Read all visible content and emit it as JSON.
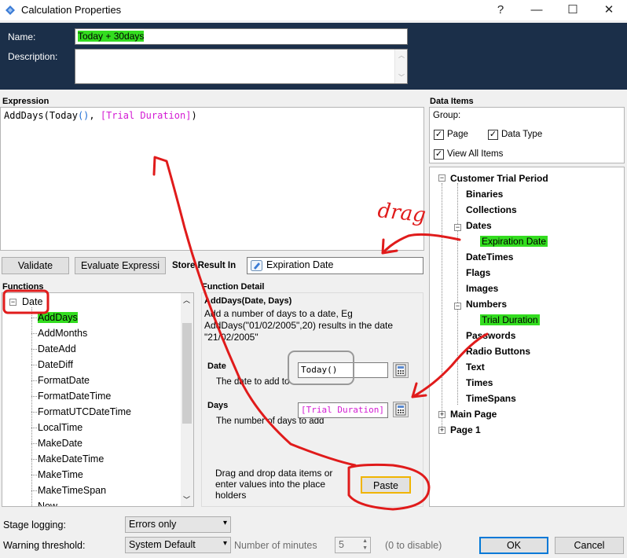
{
  "window": {
    "title": "Calculation Properties",
    "help": "?",
    "minimize": "—",
    "maximize": "☐",
    "close": "✕"
  },
  "header": {
    "name_label": "Name:",
    "name_value": "Today + 30days",
    "description_label": "Description:",
    "description_value": ""
  },
  "expression": {
    "label": "Expression",
    "fn": "AddDays",
    "open": "(",
    "fn2": "Today",
    "parens": "()",
    "sep": ", ",
    "data_item": "[Trial Duration]",
    "close": ")"
  },
  "actions": {
    "validate": "Validate",
    "evaluate": "Evaluate Expressi",
    "store_label": "Store Result In",
    "store_value": "Expiration Date"
  },
  "functions": {
    "label": "Functions",
    "group": "Date",
    "items": [
      "AddDays",
      "AddMonths",
      "DateAdd",
      "DateDiff",
      "FormatDate",
      "FormatDateTime",
      "FormatUTCDateTime",
      "LocalTime",
      "MakeDate",
      "MakeDateTime",
      "MakeTime",
      "MakeTimeSpan",
      "Now"
    ]
  },
  "detail": {
    "label": "Function Detail",
    "signature": "AddDays(Date, Days)",
    "description": "Add a number of days to a date, Eg AddDays(\"01/02/2005\",20) results in the date \"21/02/2005\"",
    "param1_name": "Date",
    "param1_desc": "The date to add to",
    "param1_value": "Today()",
    "param2_name": "Days",
    "param2_desc": "The number of days to add",
    "param2_value": "[Trial Duration]",
    "hint": "Drag and drop data items or enter values into the place holders",
    "paste": "Paste"
  },
  "data_items": {
    "label": "Data Items",
    "group_label": "Group:",
    "page": "Page",
    "data_type": "Data Type",
    "view_all": "View All Items",
    "page_checked": true,
    "data_type_checked": true,
    "view_all_checked": true,
    "root": "Customer Trial Period",
    "types": [
      "Binaries",
      "Collections",
      "Dates",
      "DateTimes",
      "Flags",
      "Images",
      "Numbers",
      "Passwords",
      "Radio Buttons",
      "Text",
      "Times",
      "TimeSpans"
    ],
    "expiration_date": "Expiration Date",
    "trial_duration": "Trial Duration",
    "main_page": "Main Page",
    "page1": "Page 1"
  },
  "bottom": {
    "stage_logging_label": "Stage logging:",
    "stage_logging_value": "Errors only",
    "warning_label": "Warning threshold:",
    "warning_value": "System Default",
    "minutes_label": "Number of minutes",
    "minutes_value": "5",
    "disable_hint": "(0 to disable)",
    "ok": "OK",
    "cancel": "Cancel"
  },
  "annotations": {
    "drag_text": "drag"
  },
  "colors": {
    "header_bg": "#1b2f49",
    "highlight": "#33dd1f",
    "annotation_red": "#e01b1b",
    "paste_outline": "#f0b400"
  }
}
